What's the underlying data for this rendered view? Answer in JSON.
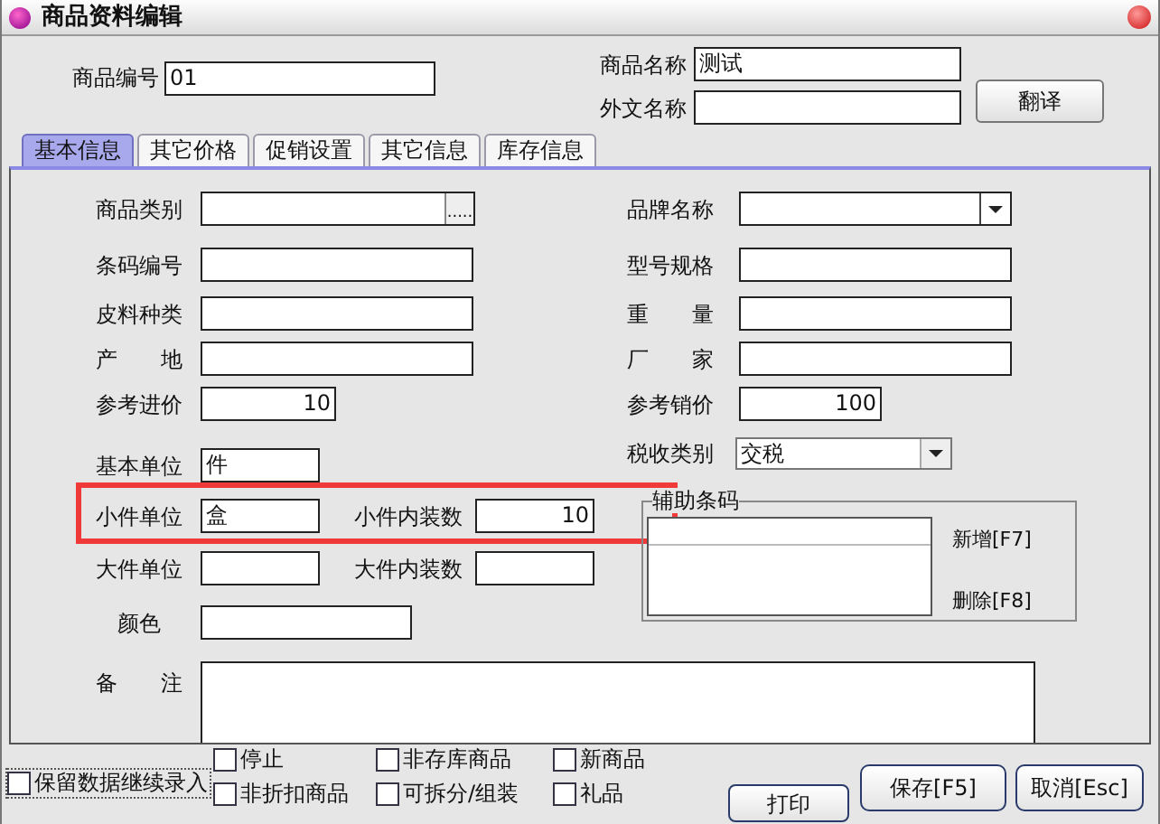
{
  "window": {
    "title": "商品资料编辑"
  },
  "header": {
    "code": {
      "label": "商品编号",
      "value": "01"
    },
    "name": {
      "label": "商品名称",
      "value": "测试"
    },
    "foreign_name": {
      "label": "外文名称"
    },
    "translate_button": "翻译"
  },
  "tabs": [
    {
      "label": "基本信息",
      "selected": true
    },
    {
      "label": "其它价格",
      "selected": false
    },
    {
      "label": "促销设置",
      "selected": false
    },
    {
      "label": "其它信息",
      "selected": false
    },
    {
      "label": "库存信息",
      "selected": false
    }
  ],
  "left_fields": [
    {
      "label": "商品类别",
      "kind": "browse",
      "browse": "....."
    },
    {
      "label": "条码编号",
      "kind": "text"
    },
    {
      "label": "皮料种类",
      "kind": "text"
    },
    {
      "label": "产　　地",
      "kind": "text"
    },
    {
      "label": "参考进价",
      "kind": "number",
      "value": "10"
    }
  ],
  "right_fields": [
    {
      "label": "品牌名称",
      "kind": "combo"
    },
    {
      "label": "型号规格",
      "kind": "text"
    },
    {
      "label": "重　　量",
      "kind": "text"
    },
    {
      "label": "厂　　家",
      "kind": "text"
    },
    {
      "label": "参考销价",
      "kind": "number",
      "value": "100"
    }
  ],
  "units": [
    {
      "label": "基本单位",
      "value": "件"
    },
    {
      "label": "小件单位",
      "value": "盒",
      "highlighted": true,
      "pack": {
        "label": "小件内装数",
        "value": "10"
      }
    },
    {
      "label": "大件单位",
      "pack": {
        "label": "大件内装数"
      }
    }
  ],
  "color": {
    "label": "颜色"
  },
  "tax": {
    "label": "税收类别",
    "value": "交税"
  },
  "aux_barcode": {
    "title": "辅助条码",
    "buttons": [
      "新增[F7]",
      "删除[F8]"
    ]
  },
  "remarks": {
    "label": "备　　注"
  },
  "keep_entry": {
    "label": "保留数据继续录入",
    "checked": false
  },
  "flags": [
    {
      "label": "停止",
      "checked": false
    },
    {
      "label": "非存库商品",
      "checked": false
    },
    {
      "label": "新商品",
      "checked": false
    },
    {
      "label": "非折扣商品",
      "checked": false
    },
    {
      "label": "可拆分/组装",
      "checked": false
    },
    {
      "label": "礼品",
      "checked": false
    }
  ],
  "buttons": [
    "打印",
    "保存[F5]",
    "取消[Esc]"
  ]
}
